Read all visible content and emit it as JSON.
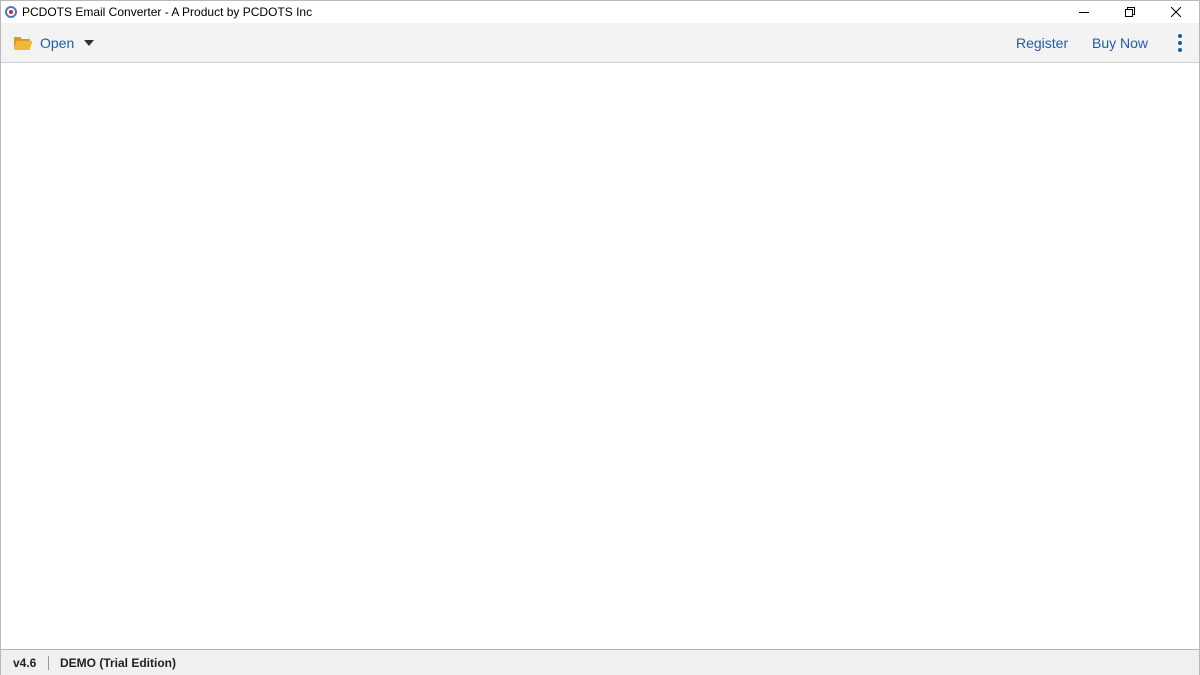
{
  "window": {
    "title": "PCDOTS Email Converter - A Product by PCDOTS Inc",
    "app_icon": "app-logo-icon",
    "controls": [
      "minimize-icon",
      "restore-icon",
      "close-icon"
    ]
  },
  "toolbar": {
    "open_label": "Open",
    "open_icon": "folder-open-icon",
    "open_dropdown_icon": "caret-down-icon",
    "register_label": "Register",
    "buy_now_label": "Buy Now",
    "more_icon": "vertical-ellipsis-icon"
  },
  "statusbar": {
    "version": "v4.6",
    "edition": "DEMO (Trial Edition)"
  },
  "colors": {
    "accent": "#1f5ca8",
    "toolbar_bg": "#f3f3f3",
    "folder": "#e3a92a",
    "statusbar_bg": "#f0f0f0"
  }
}
